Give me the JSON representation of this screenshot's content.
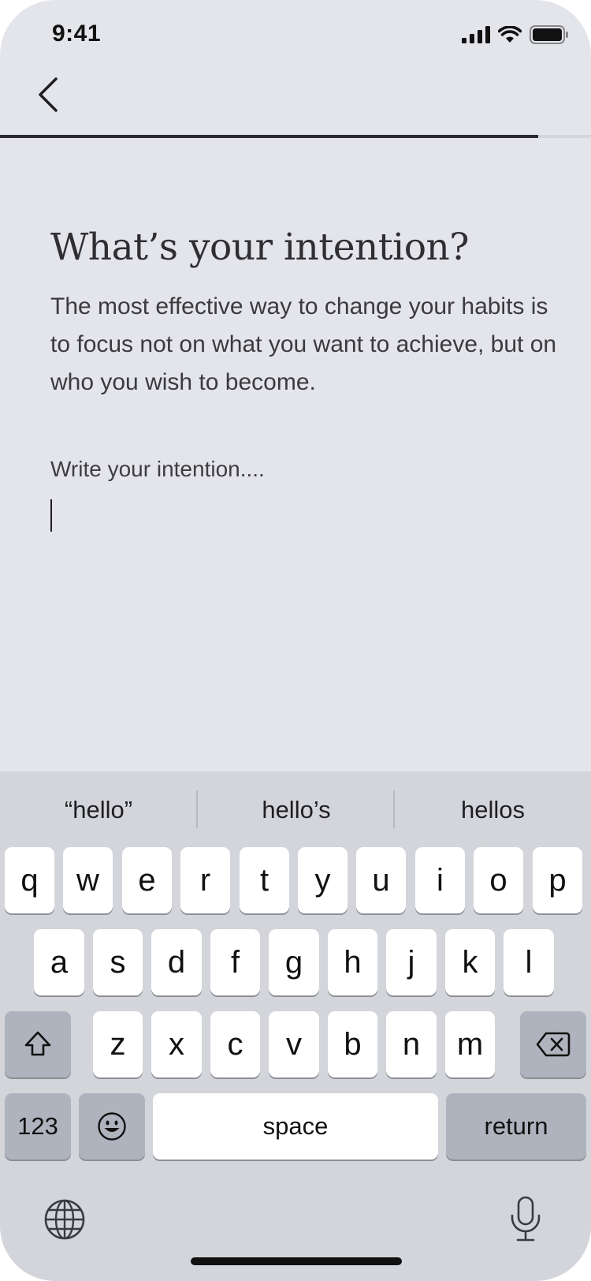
{
  "status_bar": {
    "time": "9:41"
  },
  "progress": {
    "fraction": 0.91
  },
  "content": {
    "title": "What’s your intention?",
    "description": "The most effective way to change your habits is to focus not on what you want to achieve, but on who you wish to become."
  },
  "input": {
    "value": "",
    "placeholder": "Write your intention...."
  },
  "keyboard": {
    "suggestions": [
      "“hello”",
      "hello’s",
      "hellos"
    ],
    "row1": [
      "q",
      "w",
      "e",
      "r",
      "t",
      "y",
      "u",
      "i",
      "o",
      "p"
    ],
    "row2": [
      "a",
      "s",
      "d",
      "f",
      "g",
      "h",
      "j",
      "k",
      "l"
    ],
    "row3": [
      "z",
      "x",
      "c",
      "v",
      "b",
      "n",
      "m"
    ],
    "numbers_label": "123",
    "space_label": "space",
    "return_label": "return"
  },
  "colors": {
    "background": "#e4e5ea",
    "keyboard": "#d3d5db",
    "progress": "#2b2b30"
  }
}
